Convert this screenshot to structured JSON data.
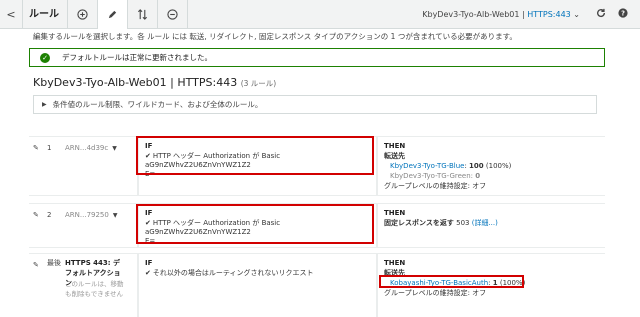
{
  "toolbar": {
    "back_glyph": "<",
    "title": "ルール",
    "lb_name": "KbyDev3-Tyo-Alb-Web01",
    "lb_sep": " | ",
    "lb_port": "HTTPS:443",
    "lb_caret": "⌄"
  },
  "description": "編集するルールを選択します。各 ルール には 転送, リダイレクト, 固定レスポンス タイプのアクションの 1 つが含まれている必要があります。",
  "success_message": "デフォルトルールは正常に更新されました。",
  "heading": {
    "title": "KbyDev3-Tyo-Alb-Web01 | HTTPS:443",
    "count": "(3 ルール)"
  },
  "filter_text": "条件値のルール制限、ワイルドカード、および全体のルール。",
  "labels": {
    "if": "IF",
    "then": "THEN"
  },
  "rules": [
    {
      "number": "1",
      "arn": "ARN...4d39c",
      "condition_line1": "HTTP ヘッダー Authorization が Basic aG9nZWhvZ2U6ZnVnYWZ1Z2",
      "condition_line2": "E=",
      "action": "転送先",
      "targets": [
        {
          "name": "KbyDev3-Tyo-TG-Blue",
          "sep": ": ",
          "weight": "100",
          "pct": "(100%)"
        },
        {
          "name": "KbyDev3-Tyo-TG-Green",
          "sep": ": ",
          "weight": "0",
          "pct": ""
        }
      ],
      "stickiness": "グループレベルの維持設定: オフ"
    },
    {
      "number": "2",
      "arn": "ARN...79250",
      "condition_line1": "HTTP ヘッダー Authorization が Basic aG9nZWhvZ2U6ZnVnYWZ1Z2",
      "condition_line2": "E=",
      "action": "固定レスポンスを返す",
      "status_code": "503",
      "details_link": "(詳細...)"
    },
    {
      "label": "最後",
      "name": "HTTPS 443: デフォルトアクション",
      "note": "このルールは、移動も削除もできません",
      "condition_line1": "それ以外の場合はルーティングされないリクエスト",
      "action": "転送先",
      "targets": [
        {
          "name": "Kobayashi-Tyo-TG-BasicAuth",
          "sep": ": ",
          "weight": "1",
          "pct": "(100%)"
        }
      ],
      "stickiness": "グループレベルの維持設定: オフ"
    }
  ]
}
